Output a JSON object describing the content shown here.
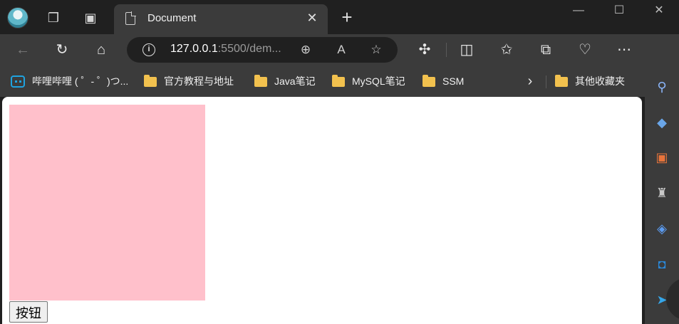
{
  "browser": {
    "tab": {
      "title": "Document",
      "close": "✕"
    },
    "new_tab": "+",
    "window_controls": {
      "minimize": "—",
      "maximize": "☐",
      "close": "✕"
    },
    "address_bar": {
      "host": "127.0.0.1",
      "rest": ":5500/dem..."
    },
    "bookmarks": [
      {
        "label": "哔哩哔哩 ( ゜- ゜)つ...",
        "icon": "bilibili-icon"
      },
      {
        "label": "官方教程与地址",
        "icon": "folder-icon"
      },
      {
        "label": "Java笔记",
        "icon": "folder-icon"
      },
      {
        "label": "MySQL笔记",
        "icon": "folder-icon"
      },
      {
        "label": "SSM",
        "icon": "folder-icon"
      }
    ],
    "other_bookmarks": "其他收藏夹",
    "chevron": "›"
  },
  "page": {
    "box_color": "#ffc0cb",
    "button_label": "按钮"
  },
  "icons": {
    "back": "←",
    "refresh": "↻",
    "home": "⌂",
    "zoom": "⊕",
    "read_aloud": "A",
    "favorite": "☆",
    "extensions": "✣",
    "split": "◫",
    "favorites_list": "✩",
    "collections": "⧉",
    "health": "♡",
    "more": "⋯",
    "sidebar_toggle": "⇥",
    "search": "⚲",
    "tag": "◆",
    "tools": "▣",
    "games": "♜",
    "office": "◈",
    "outlook": "◘",
    "send": "➤"
  }
}
